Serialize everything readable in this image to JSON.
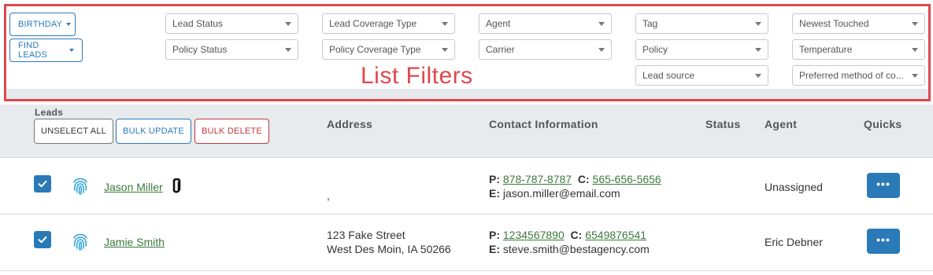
{
  "filters": {
    "birthday_label": "BIRTHDAY",
    "find_leads_label": "FIND LEADS",
    "lead_status": "Lead Status",
    "policy_status": "Policy Status",
    "lead_coverage_type": "Lead Coverage Type",
    "policy_coverage_type": "Policy Coverage Type",
    "agent": "Agent",
    "carrier": "Carrier",
    "tag": "Tag",
    "policy": "Policy",
    "lead_source": "Lead source",
    "newest_touched": "Newest Touched",
    "temperature": "Temperature",
    "preferred_method": "Preferred method of co...",
    "annotation_label": "List Filters"
  },
  "table": {
    "headers": {
      "leads": "Leads",
      "address": "Address",
      "contact": "Contact Information",
      "status": "Status",
      "agent": "Agent",
      "quicks": "Quicks"
    },
    "actions": {
      "unselect_all": "UNSELECT ALL",
      "bulk_update": "BULK UPDATE",
      "bulk_delete": "BULK DELETE"
    },
    "rows": [
      {
        "name": "Jason Miller",
        "address_line1": ",",
        "address_line2": "",
        "phone_label": "P:",
        "phone": "878-787-8787",
        "cell_label": "C:",
        "cell": "565-656-5656",
        "email_label": "E:",
        "email": "jason.miller@email.com",
        "status": "",
        "agent": "Unassigned",
        "quick_label": "•••",
        "has_attachment": true,
        "checked": true
      },
      {
        "name": "Jamie Smith",
        "address_line1": "123 Fake Street",
        "address_line2": "West Des Moin, IA 50266",
        "phone_label": "P:",
        "phone": "1234567890",
        "cell_label": "C:",
        "cell": "6549876541",
        "email_label": "E:",
        "email": "steve.smith@bestagency.com",
        "status": "",
        "agent": "Eric Debner",
        "quick_label": "•••",
        "has_attachment": false,
        "checked": true
      }
    ]
  },
  "colors": {
    "accent": "#2a7ab8",
    "annotation": "#e0474c",
    "link": "#3c7a3c",
    "danger": "#c0393d"
  }
}
